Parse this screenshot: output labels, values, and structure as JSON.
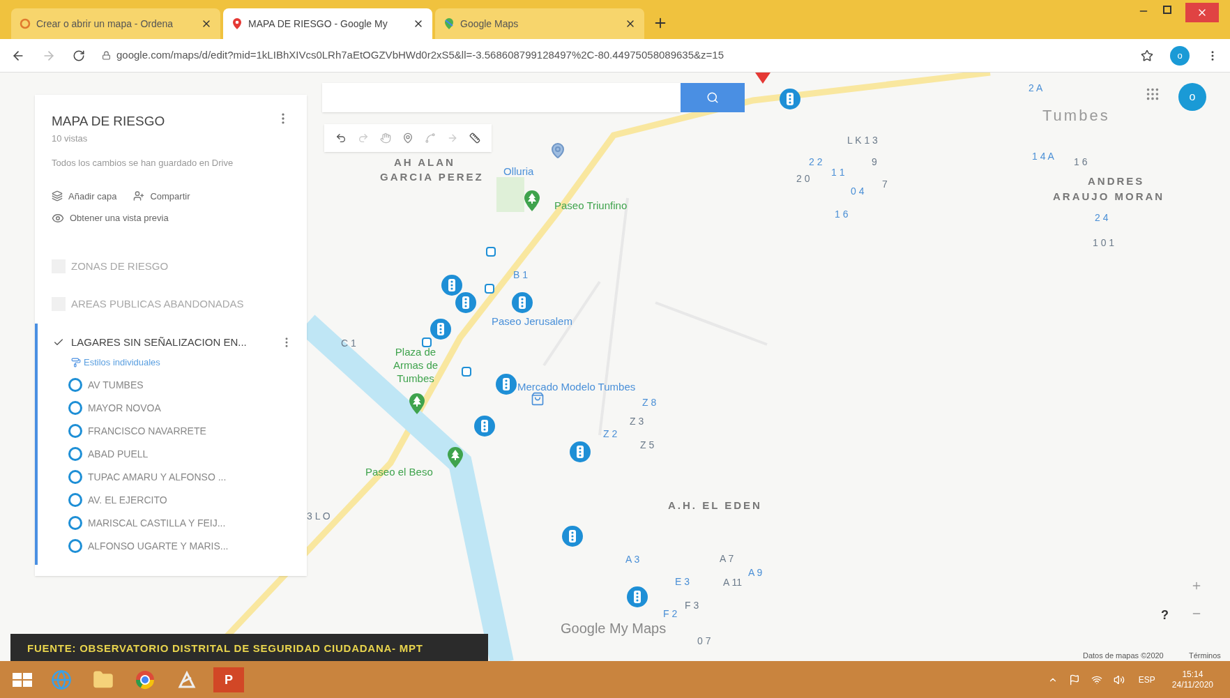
{
  "tabs": [
    {
      "title": "Crear o abrir un mapa - Ordena",
      "selected": false
    },
    {
      "title": "MAPA DE RIESGO - Google My",
      "selected": true
    },
    {
      "title": "Google Maps",
      "selected": false
    }
  ],
  "address_bar": {
    "url": "google.com/maps/d/edit?mid=1kLIBhXIVcs0LRh7aEtOGZVbHWd0r2xS5&ll=-3.568608799128497%2C-80.44975058089635&z=15",
    "avatar": "o"
  },
  "account_avatar": "o",
  "map_panel": {
    "title": "MAPA DE RIESGO",
    "views": "10 vistas",
    "save_status": "Todos los cambios se han guardado en Drive",
    "actions": [
      "Añadir capa",
      "Compartir"
    ],
    "preview": "Obtener una vista previa",
    "layers": [
      {
        "name": "ZONAS DE RIESGO",
        "checked": false,
        "selected": false
      },
      {
        "name": "AREAS PUBLICAS ABANDONADAS",
        "checked": false,
        "selected": false
      },
      {
        "name": "LAGARES SIN SEÑALIZACION EN...",
        "checked": true,
        "selected": true,
        "style_link": "Estilos individuales",
        "items": [
          "AV TUMBES",
          "MAYOR NOVOA",
          "FRANCISCO NAVARRETE",
          "ABAD PUELL",
          "TUPAC AMARU Y ALFONSO ...",
          "AV. EL EJERCITO",
          "MARISCAL CASTILLA Y FEIJ...",
          "ALFONSO UGARTE Y MARIS..."
        ]
      }
    ]
  },
  "map": {
    "places": [
      {
        "name": "Tumbes",
        "kind": "city"
      },
      {
        "name": "AH ALAN",
        "kind": "district"
      },
      {
        "name": "GARCIA PEREZ",
        "kind": "district"
      },
      {
        "name": "Olluria",
        "kind": "poi"
      },
      {
        "name": "ANDRES",
        "kind": "district"
      },
      {
        "name": "ARAUJO MORAN",
        "kind": "district"
      },
      {
        "name": "Paseo Triunfino",
        "kind": "park"
      },
      {
        "name": "Paseo Jerusalem",
        "kind": "poi"
      },
      {
        "name": "Plaza de Armas de Tumbes",
        "kind": "park"
      },
      {
        "name": "Mercado Modelo Tumbes",
        "kind": "poi"
      },
      {
        "name": "Paseo el Beso",
        "kind": "park"
      },
      {
        "name": "A.H. EL EDEN",
        "kind": "district"
      }
    ],
    "block_labels": [
      "Z 8",
      "Z 3",
      "Z 2",
      "Z 5",
      "A 3",
      "A 7",
      "A 9",
      "A 11",
      "F 2",
      "F 3",
      "E 3",
      "0 7",
      "B 1",
      "C 1",
      "2 2",
      "2 0",
      "1 1",
      "9",
      "0 4",
      "7",
      "1 6",
      "L K 1 3",
      "1 4 A",
      "1 6",
      "2 4",
      "1 0 1",
      "2 A",
      "3 L O"
    ],
    "logo": "Google My Maps",
    "attribution": "Datos de mapas ©2020",
    "terms": "Términos",
    "help": "?"
  },
  "caption": "FUENTE: OBSERVATORIO DISTRITAL DE SEGURIDAD CIUDADANA- MPT",
  "taskbar": {
    "apps": [
      {
        "kind": "ie"
      },
      {
        "kind": "explorer"
      },
      {
        "kind": "chrome"
      },
      {
        "kind": "tool"
      },
      {
        "kind": "powerpoint",
        "label": "P"
      }
    ],
    "language": "ESP",
    "time": "15:14",
    "date": "24/11/2020"
  }
}
